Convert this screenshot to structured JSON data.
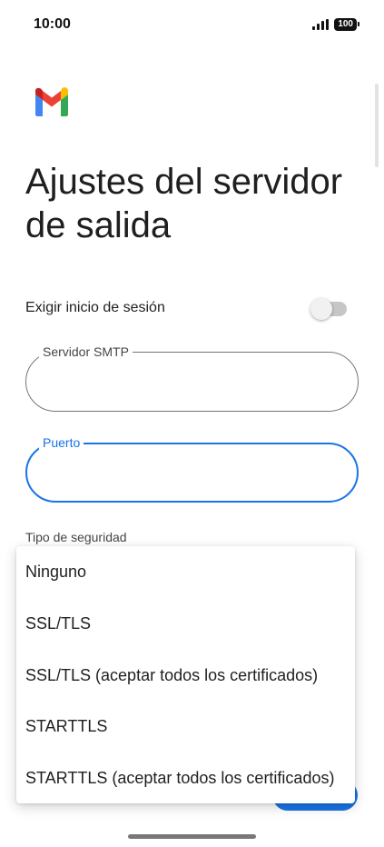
{
  "status_bar": {
    "time": "10:00",
    "battery": "100",
    "icons": [
      "signal-icon",
      "battery-icon"
    ]
  },
  "app": {
    "logo": "gmail-logo-icon"
  },
  "page": {
    "title": "Ajustes del servidor de salida"
  },
  "require_login": {
    "label": "Exigir inicio de sesión",
    "enabled": false
  },
  "smtp_server": {
    "label": "Servidor SMTP",
    "value": ""
  },
  "port": {
    "label": "Puerto",
    "value": ""
  },
  "security": {
    "label": "Tipo de seguridad",
    "options": [
      "Ninguno",
      "SSL/TLS",
      "SSL/TLS (aceptar todos los certificados)",
      "STARTTLS",
      "STARTTLS (aceptar todos los certificados)"
    ]
  },
  "colors": {
    "accent": "#1a73e8",
    "text": "#1f1f1f",
    "outline": "#747775"
  }
}
